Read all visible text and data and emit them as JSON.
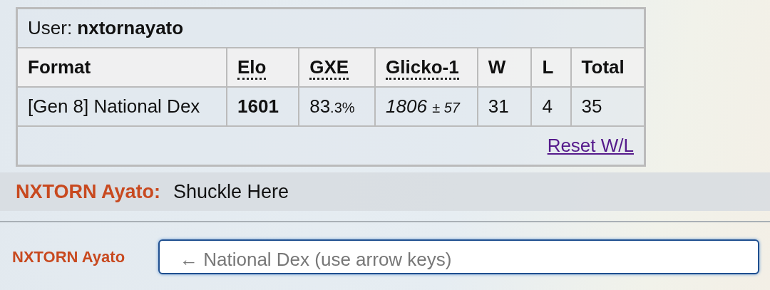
{
  "user": {
    "label": "User:",
    "name": "nxtornayato"
  },
  "table": {
    "columns": [
      {
        "label": "Format",
        "abbr": false
      },
      {
        "label": "Elo",
        "abbr": true
      },
      {
        "label": "GXE",
        "abbr": true
      },
      {
        "label": "Glicko-1",
        "abbr": true
      },
      {
        "label": "W",
        "abbr": false
      },
      {
        "label": "L",
        "abbr": false
      },
      {
        "label": "Total",
        "abbr": false
      }
    ],
    "rows": [
      {
        "format": "[Gen 8] National Dex",
        "elo": "1601",
        "gxe": {
          "whole": "83",
          "fraction": ".3%"
        },
        "glicko": {
          "rating": "1806",
          "deviation": "± 57"
        },
        "w": "31",
        "l": "4",
        "total": "35"
      }
    ]
  },
  "reset_link": "Reset W/L",
  "chat": [
    {
      "author": "NXTORN Ayato:",
      "message": "Shuckle Here"
    }
  ],
  "composer": {
    "name": "NXTORN Ayato",
    "placeholder": "← National Dex (use arrow keys)"
  }
}
